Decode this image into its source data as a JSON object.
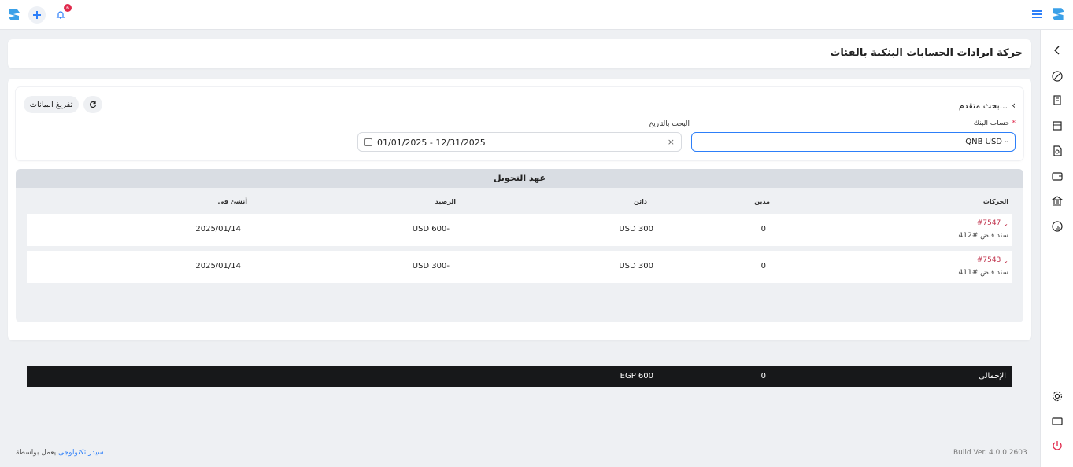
{
  "topbar": {
    "notification_count": "6",
    "icons": [
      "logo-icon",
      "plus-icon",
      "bell-icon",
      "hamburger-icon"
    ]
  },
  "sidebar": {
    "icons": [
      "chevron-left-icon",
      "dashboard-icon",
      "invoice-icon",
      "cash-register-icon",
      "document-search-icon",
      "wallet-icon",
      "bank-icon",
      "report-chart-icon",
      "settings-icon",
      "screen-icon",
      "power-icon"
    ]
  },
  "page": {
    "title": "حركة ايرادات الحسابات البنكية بالفئات"
  },
  "filters": {
    "advanced_search": "بحث متقدم...",
    "clear_button": "تفريغ البيانات",
    "bank_label": "حساب البنك",
    "required_mark": "*",
    "bank_value": "QNB USD",
    "date_label": "البحث بالتاريخ",
    "date_value": "01/01/2025 - 12/31/2025"
  },
  "table": {
    "section_title": "عهد التحويل",
    "headers": {
      "movements": "الحركات",
      "debit": "مدين",
      "credit": "دائن",
      "balance": "الرصيد",
      "created": "أنشئ فى"
    },
    "rows": [
      {
        "ref": "#7547",
        "sub": "سند قبض #412",
        "debit": "0",
        "credit": "USD 300",
        "balance": "USD 600-",
        "date": "2025/01/14"
      },
      {
        "ref": "#7543",
        "sub": "سند قبض #411",
        "debit": "0",
        "credit": "USD 300",
        "balance": "USD 300-",
        "date": "2025/01/14"
      }
    ],
    "total": {
      "label": "الإجمالى",
      "debit": "0",
      "credit": "EGP 600"
    }
  },
  "footer": {
    "powered_prefix": "يعمل بواسطة",
    "powered_link": "سيدر تكنولوجى",
    "build": "Build Ver. 4.0.0.2603"
  },
  "colors": {
    "accent": "#2d7ff9",
    "badge": "#e0294c",
    "ref_link": "#c0334d",
    "total_row": "#17181a"
  }
}
